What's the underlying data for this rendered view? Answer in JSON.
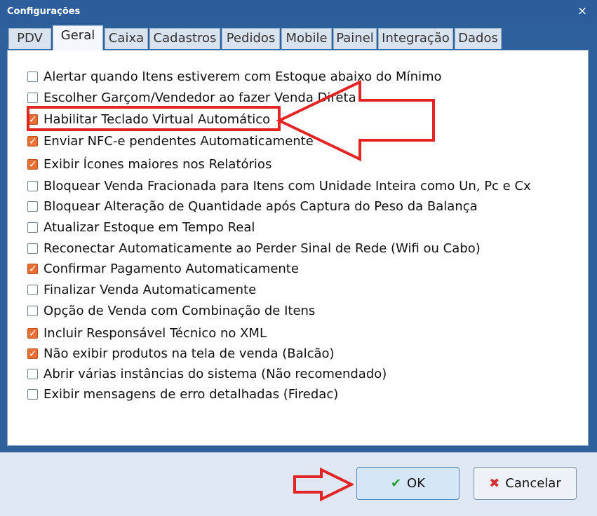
{
  "window": {
    "title": "Configurações",
    "close_symbol": "×"
  },
  "tabs": [
    {
      "label": "PDV"
    },
    {
      "label": "Geral"
    },
    {
      "label": "Caixa"
    },
    {
      "label": "Cadastros"
    },
    {
      "label": "Pedidos"
    },
    {
      "label": "Mobile"
    },
    {
      "label": "Painel"
    },
    {
      "label": "Integração"
    },
    {
      "label": "Dados"
    }
  ],
  "options": [
    {
      "label": "Alertar quando Itens estiverem com Estoque abaixo do Mínimo",
      "checked": false
    },
    {
      "label": "Escolher Garçom/Vendedor ao fazer Venda Direta",
      "checked": false
    },
    {
      "label": "Habilitar Teclado Virtual Automático",
      "checked": true
    },
    {
      "label": "Enviar NFC-e pendentes Automaticamente",
      "checked": true
    },
    {
      "label": "Exibir Ícones maiores nos Relatórios",
      "checked": true
    },
    {
      "label": "Bloquear Venda Fracionada para Itens com Unidade Inteira como Un, Pc e Cx",
      "checked": false
    },
    {
      "label": "Bloquear Alteração de Quantidade após Captura do Peso da Balança",
      "checked": false
    },
    {
      "label": "Atualizar Estoque em Tempo Real",
      "checked": false
    },
    {
      "label": "Reconectar Automaticamente ao Perder Sinal de Rede (Wifi ou Cabo)",
      "checked": false
    },
    {
      "label": "Confirmar Pagamento Automaticamente",
      "checked": true
    },
    {
      "label": "Finalizar Venda Automaticamente",
      "checked": false
    },
    {
      "label": "Opção de Venda com Combinação de Itens",
      "checked": false
    },
    {
      "label": "Incluir Responsável Técnico no XML",
      "checked": true
    },
    {
      "label": "Não exibir produtos na tela de venda (Balcão)",
      "checked": true
    },
    {
      "label": "Abrir várias instâncias do sistema (Não recomendado)",
      "checked": false
    },
    {
      "label": "Exibir mensagens de erro detalhadas (Firedac)",
      "checked": false
    }
  ],
  "buttons": {
    "ok_label": "OK",
    "ok_icon": "✔",
    "cancel_label": "Cancelar",
    "cancel_icon": "✖"
  },
  "colors": {
    "titlebar": "#2d5e9b",
    "checkbox_checked": "#e86f35",
    "annotation_red": "#e32424"
  }
}
